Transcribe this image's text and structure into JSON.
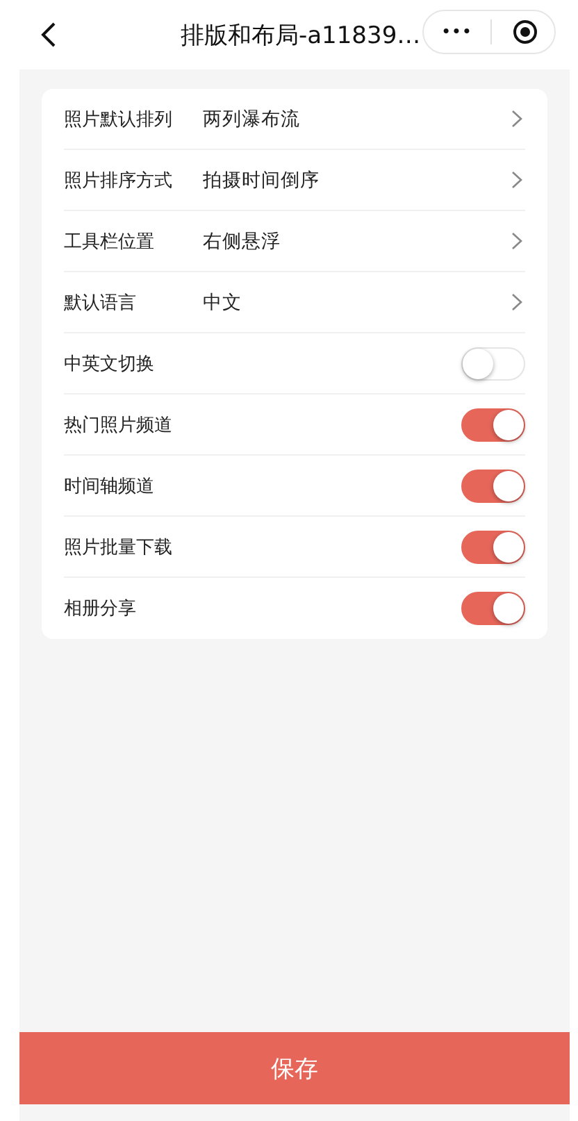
{
  "nav_bar": {
    "title": "排版和布局-a11839…",
    "more_icon": "•••"
  },
  "settings": [
    {
      "kind": "select",
      "label": "照片默认排列",
      "value": "两列瀑布流"
    },
    {
      "kind": "select",
      "label": "照片排序方式",
      "value": "拍摄时间倒序"
    },
    {
      "kind": "select",
      "label": "工具栏位置",
      "value": "右侧悬浮"
    },
    {
      "kind": "select",
      "label": "默认语言",
      "value": "中文"
    },
    {
      "kind": "toggle",
      "label": "中英文切换",
      "on": false
    },
    {
      "kind": "toggle",
      "label": "热门照片频道",
      "on": true
    },
    {
      "kind": "toggle",
      "label": "时间轴频道",
      "on": true
    },
    {
      "kind": "toggle",
      "label": "照片批量下载",
      "on": true
    },
    {
      "kind": "toggle",
      "label": "相册分享",
      "on": true
    }
  ],
  "save_button": "保存"
}
